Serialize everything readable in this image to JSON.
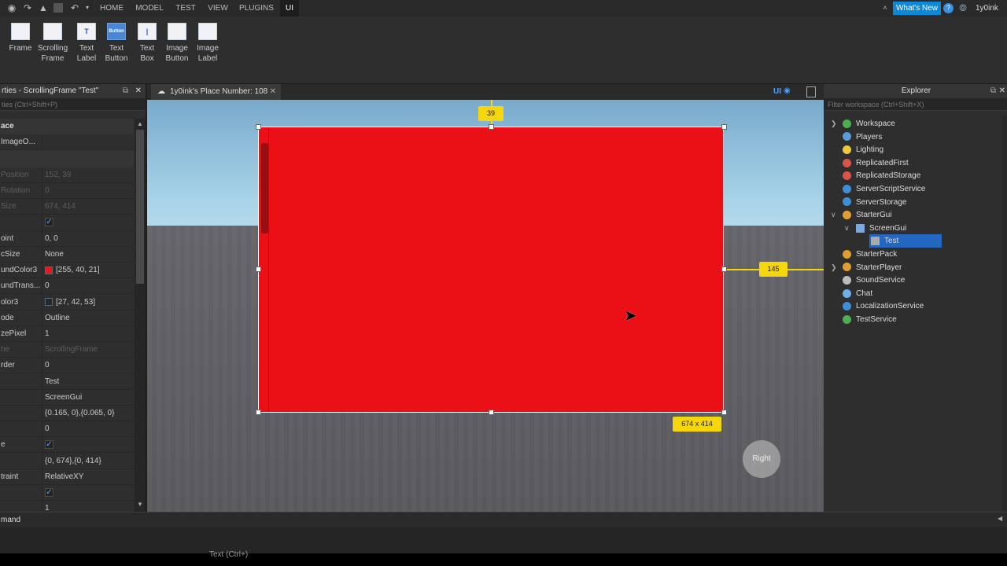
{
  "topbar": {
    "menus": [
      "HOME",
      "MODEL",
      "TEST",
      "VIEW",
      "PLUGINS",
      "UI"
    ],
    "active_menu": "UI",
    "whats_new": "What's New",
    "username": "1y0ink"
  },
  "ribbon": {
    "items": [
      {
        "label1": "Frame",
        "label2": "",
        "icon": "frame-icon",
        "glyph": ""
      },
      {
        "label1": "Scrolling",
        "label2": "Frame",
        "icon": "scrolling-frame-icon",
        "glyph": ""
      },
      {
        "label1": "Text",
        "label2": "Label",
        "icon": "text-label-icon",
        "glyph": "T"
      },
      {
        "label1": "Text",
        "label2": "Button",
        "icon": "text-button-icon",
        "glyph": "Button"
      },
      {
        "label1": "Text",
        "label2": "Box",
        "icon": "text-box-icon",
        "glyph": "|"
      },
      {
        "label1": "Image",
        "label2": "Button",
        "icon": "image-button-icon",
        "glyph": ""
      },
      {
        "label1": "Image",
        "label2": "Label",
        "icon": "image-label-icon",
        "glyph": ""
      }
    ]
  },
  "properties": {
    "title": "rties - ScrollingFrame \"Test\"",
    "filter_placeholder": "ties (Ctrl+Shift+P)",
    "section": "ace",
    "sub": "ImageO...",
    "rows": [
      {
        "k": "Position",
        "v": "152, 39",
        "dim": true
      },
      {
        "k": "Rotation",
        "v": "0",
        "dim": true
      },
      {
        "k": "Size",
        "v": "674, 414",
        "dim": true
      },
      {
        "k": "",
        "v": "",
        "check": true
      },
      {
        "k": "oint",
        "v": "0, 0"
      },
      {
        "k": "cSize",
        "v": "None"
      },
      {
        "k": "undColor3",
        "v": "[255, 40, 21]",
        "swatch": "#e8151a"
      },
      {
        "k": "undTrans...",
        "v": "0"
      },
      {
        "k": "olor3",
        "v": "[27, 42, 53]",
        "swatch": "#1b2a35"
      },
      {
        "k": "ode",
        "v": "Outline"
      },
      {
        "k": "zePixel",
        "v": "1"
      },
      {
        "k": "he",
        "v": "ScrollingFrame",
        "dim": true
      },
      {
        "k": "rder",
        "v": "0"
      },
      {
        "k": "",
        "v": "Test"
      },
      {
        "k": "",
        "v": "ScreenGui"
      },
      {
        "k": "",
        "v": "{0.165, 0},{0.065, 0}"
      },
      {
        "k": "",
        "v": "0"
      },
      {
        "k": "e",
        "v": "",
        "check": true
      },
      {
        "k": "",
        "v": "{0, 674},{0, 414}"
      },
      {
        "k": "traint",
        "v": "RelativeXY"
      },
      {
        "k": "",
        "v": "",
        "check": true
      },
      {
        "k": "",
        "v": "1"
      }
    ]
  },
  "document_tab": {
    "label": "1y0ink's Place Number: 108"
  },
  "viewport": {
    "top_offset": "39",
    "right_offset": "145",
    "size_label": "674 x 414",
    "view_cube": "Right",
    "ui_toggle": "UI",
    "frame_color": "#eb1016"
  },
  "explorer": {
    "title": "Explorer",
    "filter_placeholder": "Filter workspace (Ctrl+Shift+X)",
    "items": [
      {
        "label": "Workspace",
        "indent": 0,
        "expand": ">",
        "color": "#4caf50"
      },
      {
        "label": "Players",
        "indent": 0,
        "expand": "",
        "color": "#5a9bd8"
      },
      {
        "label": "Lighting",
        "indent": 0,
        "expand": "",
        "color": "#f0c93a"
      },
      {
        "label": "ReplicatedFirst",
        "indent": 0,
        "expand": "",
        "color": "#d9534f"
      },
      {
        "label": "ReplicatedStorage",
        "indent": 0,
        "expand": "",
        "color": "#d9534f"
      },
      {
        "label": "ServerScriptService",
        "indent": 0,
        "expand": "",
        "color": "#3d8ed8"
      },
      {
        "label": "ServerStorage",
        "indent": 0,
        "expand": "",
        "color": "#3d8ed8"
      },
      {
        "label": "StarterGui",
        "indent": 0,
        "expand": "v",
        "color": "#e0a030"
      },
      {
        "label": "ScreenGui",
        "indent": 1,
        "expand": "v",
        "color": "#7aa9e0"
      },
      {
        "label": "Test",
        "indent": 2,
        "expand": "",
        "color": "#aaaaaa",
        "selected": true
      },
      {
        "label": "StarterPack",
        "indent": 0,
        "expand": "",
        "color": "#e0a030"
      },
      {
        "label": "StarterPlayer",
        "indent": 0,
        "expand": ">",
        "color": "#e0a030"
      },
      {
        "label": "SoundService",
        "indent": 0,
        "expand": "",
        "color": "#bbbbbb"
      },
      {
        "label": "Chat",
        "indent": 0,
        "expand": "",
        "color": "#6fb0e8"
      },
      {
        "label": "LocalizationService",
        "indent": 0,
        "expand": "",
        "color": "#3d8ed8"
      },
      {
        "label": "TestService",
        "indent": 0,
        "expand": "",
        "color": "#4caf50"
      }
    ]
  },
  "command_bar": {
    "label": "mand"
  },
  "status": {
    "text": "Text (Ctrl+)"
  }
}
